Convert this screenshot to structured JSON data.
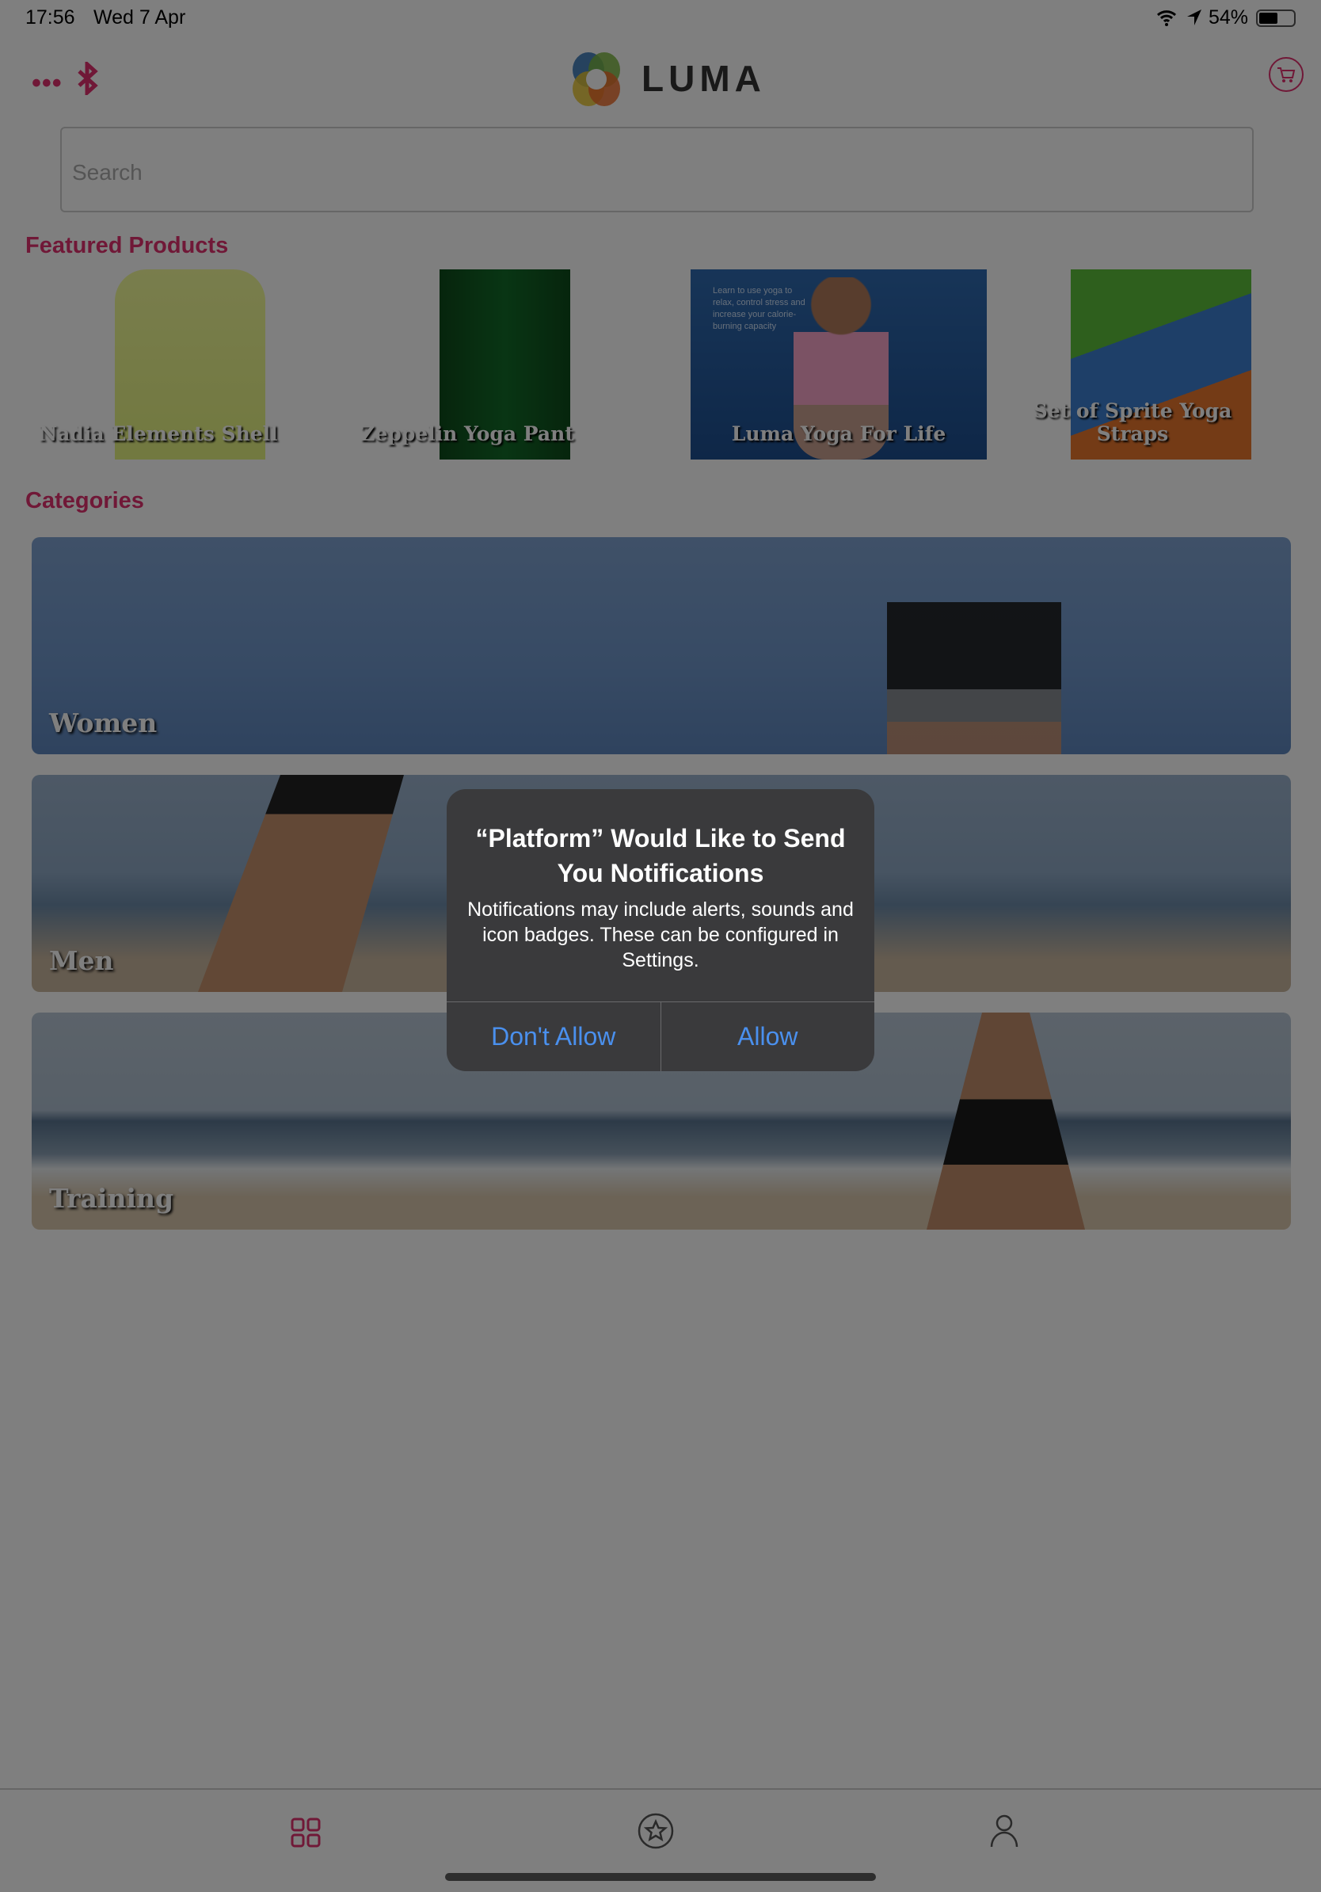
{
  "status_bar": {
    "time": "17:56",
    "date": "Wed 7 Apr",
    "battery": "54%",
    "battery_level": 0.54
  },
  "header": {
    "logo_text": "LUMA"
  },
  "search": {
    "placeholder": "Search"
  },
  "featured": {
    "heading": "Featured Products",
    "items": [
      {
        "label": "Nadia Elements Shell"
      },
      {
        "label": "Zeppelin Yoga Pant"
      },
      {
        "label": "Luma Yoga For Life",
        "cover_text": "Learn to use yoga to relax, control stress and increase your calorie-burning capacity"
      },
      {
        "label": "Set of Sprite Yoga Straps"
      }
    ]
  },
  "categories": {
    "heading": "Categories",
    "items": [
      {
        "label": "Women"
      },
      {
        "label": "Men"
      },
      {
        "label": "Training"
      }
    ]
  },
  "dialog": {
    "title": "“Platform” Would Like to Send You Notifications",
    "body": "Notifications may include alerts, sounds and icon badges. These can be configured in Settings.",
    "deny": "Don't Allow",
    "allow": "Allow"
  },
  "colors": {
    "accent": "#e0306f",
    "dialog_button": "#4a90ee"
  }
}
